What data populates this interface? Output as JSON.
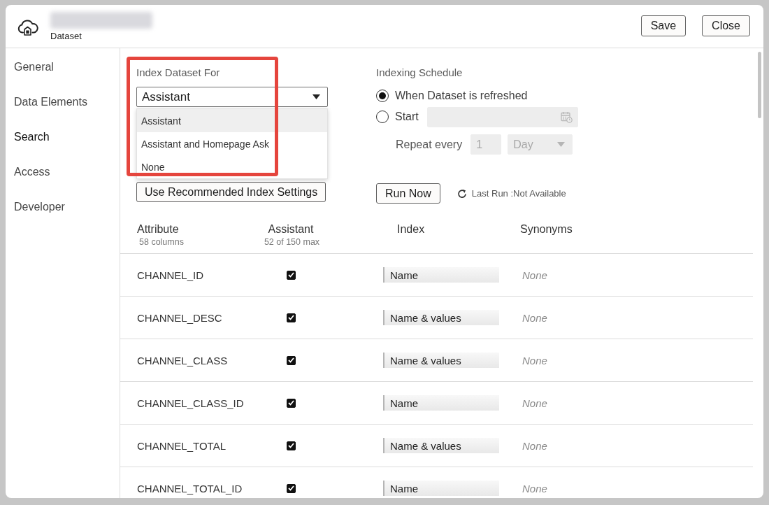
{
  "header": {
    "subtitle": "Dataset",
    "buttons": [
      "Save",
      "Close"
    ]
  },
  "sidebar": {
    "items": [
      {
        "label": "General",
        "selected": false
      },
      {
        "label": "Data Elements",
        "selected": false
      },
      {
        "label": "Search",
        "selected": true
      },
      {
        "label": "Access",
        "selected": false
      },
      {
        "label": "Developer",
        "selected": false
      }
    ]
  },
  "index_dataset_for": {
    "label": "Index Dataset For",
    "value": "Assistant",
    "options": [
      {
        "label": "Assistant",
        "selected": true
      },
      {
        "label": "Assistant and Homepage Ask",
        "selected": false
      },
      {
        "label": "None",
        "selected": false
      }
    ]
  },
  "recommended_button": "Use Recommended Index Settings",
  "indexing_schedule": {
    "label": "Indexing Schedule",
    "options": [
      {
        "label": "When Dataset is refreshed",
        "selected": true
      },
      {
        "label": "Start",
        "selected": false,
        "field": {
          "disabled": true
        }
      }
    ],
    "repeat": {
      "label": "Repeat every",
      "count": "1",
      "unit": "Day",
      "disabled": true
    },
    "run_button": "Run Now",
    "last_run": "Last Run :Not Available"
  },
  "table": {
    "columns": [
      {
        "title": "Attribute",
        "subtitle": "58 columns"
      },
      {
        "title": "Assistant",
        "subtitle": "52 of 150 max"
      },
      {
        "title": "Index"
      },
      {
        "title": "Synonyms"
      }
    ],
    "rows": [
      {
        "attribute": "CHANNEL_ID",
        "assistant": true,
        "index": "Name",
        "synonyms": "None"
      },
      {
        "attribute": "CHANNEL_DESC",
        "assistant": true,
        "index": "Name & values",
        "synonyms": "None"
      },
      {
        "attribute": "CHANNEL_CLASS",
        "assistant": true,
        "index": "Name & values",
        "synonyms": "None"
      },
      {
        "attribute": "CHANNEL_CLASS_ID",
        "assistant": true,
        "index": "Name",
        "synonyms": "None"
      },
      {
        "attribute": "CHANNEL_TOTAL",
        "assistant": true,
        "index": "Name & values",
        "synonyms": "None"
      },
      {
        "attribute": "CHANNEL_TOTAL_ID",
        "assistant": true,
        "index": "Name",
        "synonyms": "None"
      }
    ]
  }
}
